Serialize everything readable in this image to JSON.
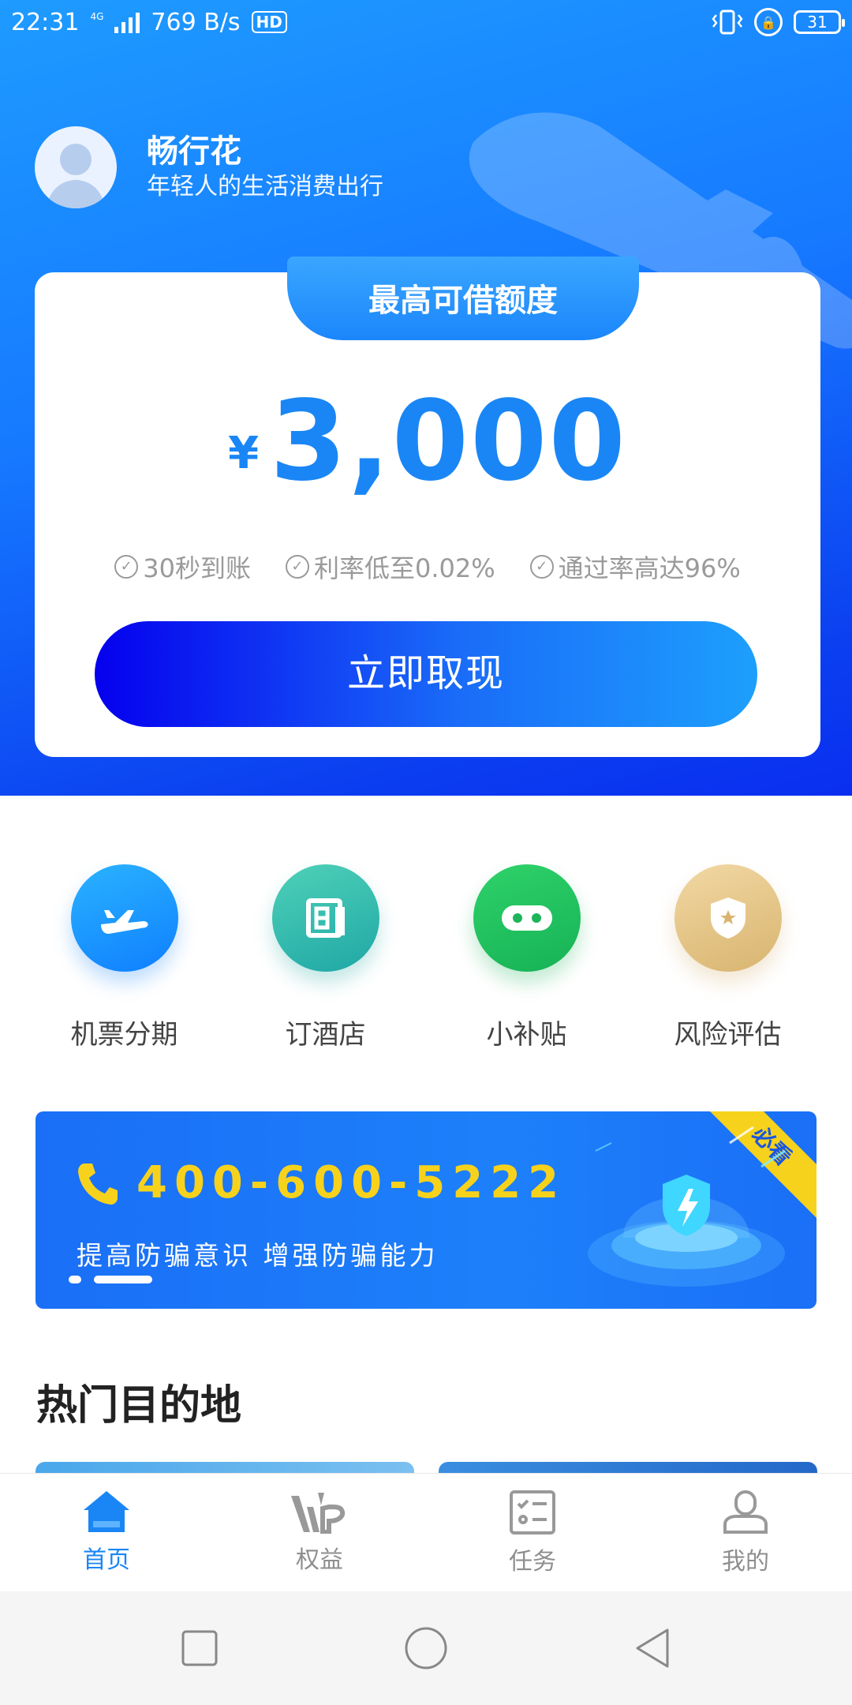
{
  "status_bar": {
    "time": "22:31",
    "network_type": "4G",
    "net_speed": "769 B/s",
    "hd_label": "HD",
    "battery": "31"
  },
  "profile": {
    "name": "畅行花",
    "subtitle": "年轻人的生活消费出行"
  },
  "credit_card": {
    "tab_title": "最高可借额度",
    "currency": "¥",
    "amount": "3,000",
    "features": [
      "30秒到账",
      "利率低至0.02%",
      "通过率高达96%"
    ],
    "cta_label": "立即取现"
  },
  "services": [
    {
      "label": "机票分期",
      "icon": "airplane-icon",
      "color": "#1a86f5"
    },
    {
      "label": "订酒店",
      "icon": "hotel-icon",
      "color": "#26aaa0"
    },
    {
      "label": "小补贴",
      "icon": "subsidy-icon",
      "color": "#1db45a"
    },
    {
      "label": "风险评估",
      "icon": "shield-star-icon",
      "color": "#d8b46f"
    }
  ],
  "banner": {
    "ribbon": "必看",
    "phone": "400-600-5222",
    "slogan": "提高防骗意识 增强防骗能力",
    "active_slide": 2,
    "slide_count": 2
  },
  "section": {
    "hot_destinations_title": "热门目的地"
  },
  "tabbar": {
    "items": [
      {
        "label": "首页",
        "icon": "home-icon",
        "active": true
      },
      {
        "label": "权益",
        "icon": "vip-icon",
        "active": false
      },
      {
        "label": "任务",
        "icon": "task-list-icon",
        "active": false
      },
      {
        "label": "我的",
        "icon": "profile-icon",
        "active": false
      }
    ]
  },
  "colors": {
    "primary": "#1a86f5",
    "cta_start": "#0500ee",
    "banner_accent": "#f7d21c"
  }
}
